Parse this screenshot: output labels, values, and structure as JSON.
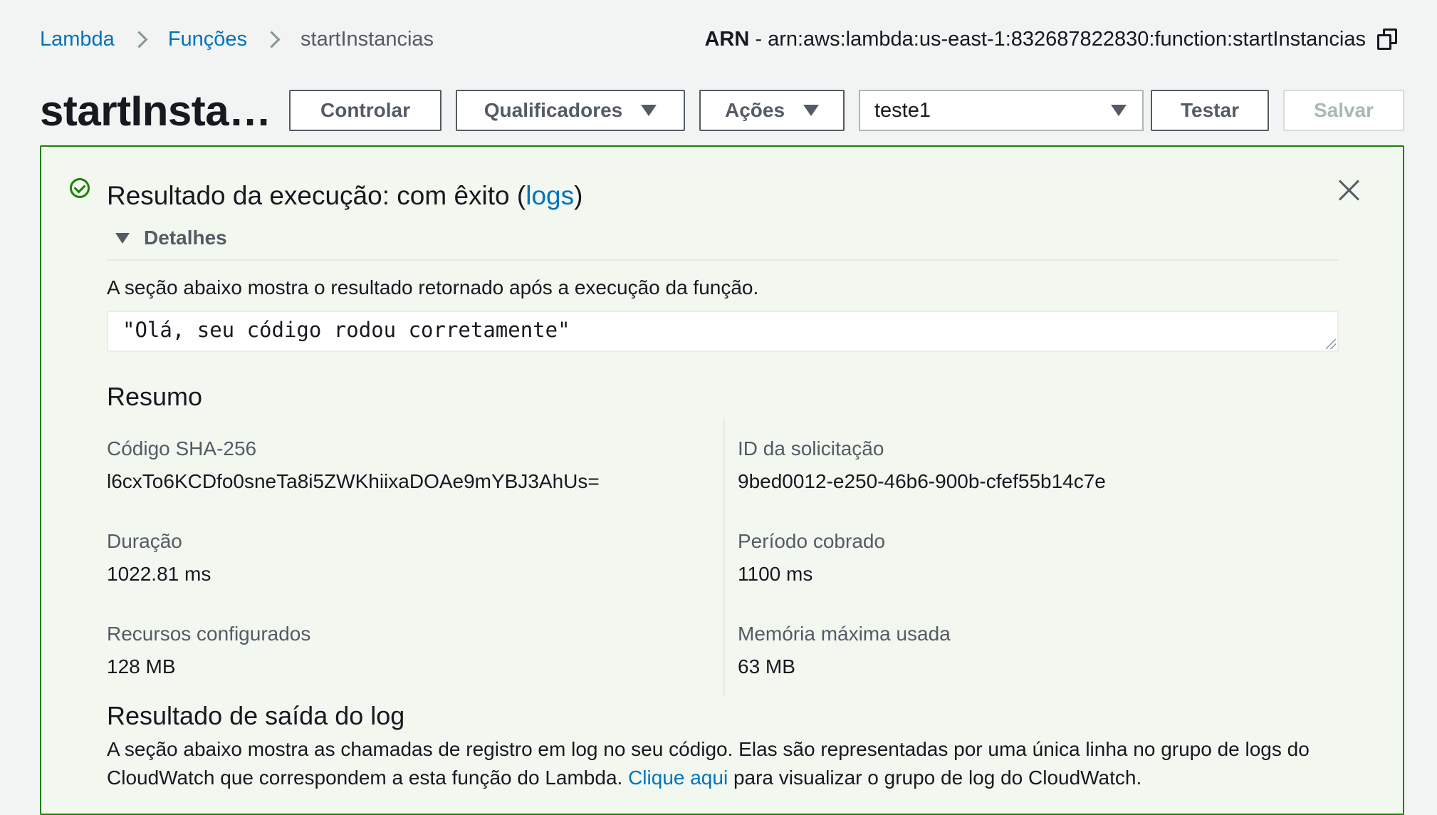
{
  "breadcrumb": {
    "items": [
      "Lambda",
      "Funções"
    ],
    "current": "startInstancias"
  },
  "arn": {
    "label": "ARN",
    "separator": " - ",
    "value": "arn:aws:lambda:us-east-1:832687822830:function:startInstancias"
  },
  "header": {
    "title": "startInstancias",
    "buttons": {
      "throttle": "Controlar",
      "qualifiers": "Qualificadores",
      "actions": "Ações",
      "test": "Testar",
      "save": "Salvar"
    },
    "test_event": "teste1"
  },
  "result": {
    "heading_prefix": "Resultado da execução: com êxito (",
    "heading_link": "logs",
    "heading_suffix": ")",
    "details_label": "Detalhes",
    "description": "A seção abaixo mostra o resultado retornado após a execução da função.",
    "output": "\"Olá, seu código rodou corretamente\"",
    "summary": {
      "title": "Resumo",
      "sha_label": "Código SHA-256",
      "sha_value": "l6cxTo6KCDfo0sneTa8i5ZWKhiixaDOAe9mYBJ3AhUs=",
      "request_label": "ID da solicitação",
      "request_value": "9bed0012-e250-46b6-900b-cfef55b14c7e",
      "duration_label": "Duração",
      "duration_value": "1022.81 ms",
      "billed_label": "Período cobrado",
      "billed_value": "1100 ms",
      "resources_label": "Recursos configurados",
      "resources_value": "128 MB",
      "memory_label": "Memória máxima usada",
      "memory_value": "63 MB"
    },
    "log": {
      "title": "Resultado de saída do log",
      "text_before": "A seção abaixo mostra as chamadas de registro em log no seu código. Elas são representadas por uma única linha no grupo de logs do CloudWatch que correspondem a esta função do Lambda. ",
      "link": "Clique aqui",
      "text_after": " para visualizar o grupo de log do CloudWatch."
    }
  },
  "colors": {
    "link": "#0073bb",
    "success": "#1d8102",
    "background": "#f2f3f3"
  }
}
